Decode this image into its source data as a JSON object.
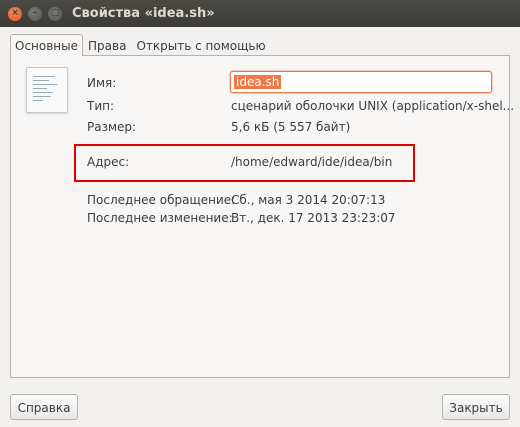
{
  "window": {
    "title": "Свойства «idea.sh»",
    "controls": {
      "close": "×",
      "minimize": "–",
      "maximize": "□"
    }
  },
  "tabs": [
    "Основные",
    "Права",
    "Открыть с помощью"
  ],
  "active_tab": "Основные",
  "file_icon": "shell-script-document-icon",
  "properties": {
    "name_label": "Имя:",
    "name_value": "idea.sh",
    "type_label": "Тип:",
    "type_value": "сценарий оболочки UNIX (application/x-shel...",
    "size_label": "Размер:",
    "size_value": "5,6 кБ (5 557 байт)",
    "location_label": "Адрес:",
    "location_value": "/home/edward/ide/idea/bin",
    "accessed_label": "Последнее обращение:",
    "accessed_value": "Сб., мая  3 2014 20:07:13",
    "modified_label": "Последнее изменение:",
    "modified_value": "Вт., дек. 17 2013 23:23:07"
  },
  "buttons": {
    "help": "Справка",
    "close": "Закрыть"
  },
  "colors": {
    "highlight_box": "#e00000",
    "accent": "#f07746",
    "titlebar": "#3c3b37"
  }
}
